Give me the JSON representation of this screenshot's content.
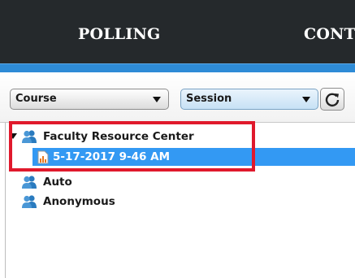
{
  "header": {
    "tabs": [
      {
        "label": "POLLING"
      },
      {
        "label": "CONT"
      }
    ]
  },
  "toolbar": {
    "course_select": {
      "value": "Course"
    },
    "session_select": {
      "value": "Session"
    },
    "refresh_icon": "refresh-icon"
  },
  "tree": {
    "items": [
      {
        "label": "Faculty Resource Center",
        "icon": "people-icon",
        "expanded": true
      },
      {
        "label": "5-17-2017 9-46 AM",
        "icon": "chart-document-icon",
        "selected": true
      },
      {
        "label": "Auto",
        "icon": "people-icon"
      },
      {
        "label": "Anonymous",
        "icon": "people-icon"
      }
    ]
  },
  "colors": {
    "header_bg": "#25292c",
    "accent": "#2e8bd6",
    "selection": "#3399f3",
    "highlight_box": "#e0192c",
    "people_icon": "#2a7bbf"
  }
}
